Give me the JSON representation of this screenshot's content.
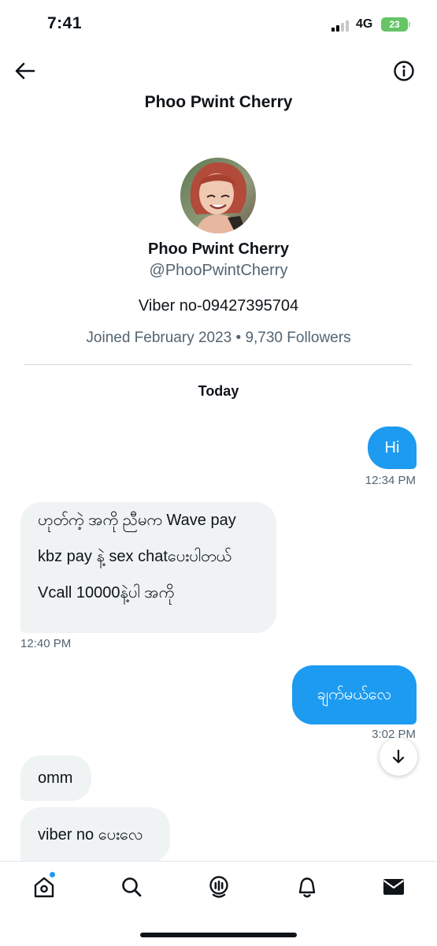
{
  "status_bar": {
    "time": "7:41",
    "network": "4G",
    "battery": "23"
  },
  "header": {
    "title": "Phoo Pwint Cherry",
    "back_icon": "arrow-left-icon",
    "info_icon": "info-circle-icon"
  },
  "profile": {
    "name": "Phoo Pwint Cherry",
    "handle": "@PhooPwintCherry",
    "bio": "Viber no-09427395704",
    "meta": "Joined February 2023 • 9,730 Followers"
  },
  "conversation": {
    "day_label": "Today",
    "messages": [
      {
        "direction": "out",
        "lines": [
          "Hi"
        ],
        "time": "12:34 PM"
      },
      {
        "direction": "in",
        "lines": [
          "ဟုတ်ကဲ့ အကို ညီမက Wave pay",
          "kbz pay နဲ့ sex chatပေးပါတယ်",
          "Vcall 10000နဲ့ပါ အကို"
        ],
        "time": "12:40 PM"
      },
      {
        "direction": "out",
        "lines": [
          "ချက်မယ်လေ"
        ],
        "time": "3:02 PM"
      },
      {
        "direction": "in",
        "lines": [
          "omm"
        ],
        "time": ""
      },
      {
        "direction": "in",
        "lines": [
          "viber no ပေးလေ"
        ],
        "time": ""
      }
    ]
  },
  "tabbar": {
    "items": [
      "home-icon",
      "search-icon",
      "spaces-icon",
      "bell-icon",
      "mail-icon"
    ],
    "accent": "#1d9bf0"
  },
  "colors": {
    "accent": "#1d9bf0",
    "incoming_bubble": "#eff3f4",
    "secondary_text": "#536471"
  }
}
